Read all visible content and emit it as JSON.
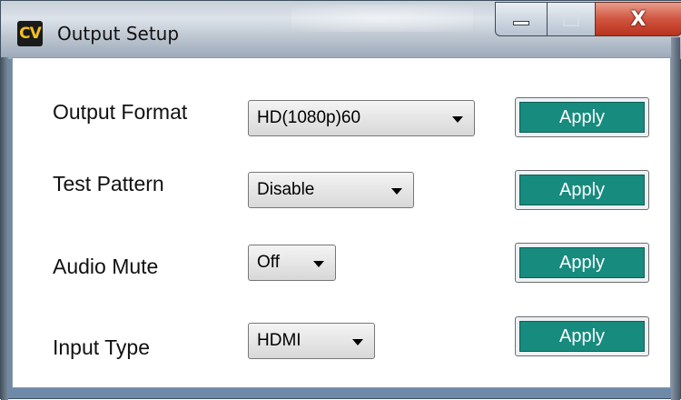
{
  "window": {
    "title": "Output Setup",
    "icon_text": "CV",
    "icon_name": "cv-app-icon",
    "close_glyph": "X"
  },
  "rows": [
    {
      "label": "Output Format",
      "value": "HD(1080p)60",
      "button": "Apply"
    },
    {
      "label": "Test Pattern",
      "value": "Disable",
      "button": "Apply"
    },
    {
      "label": "Audio Mute",
      "value": "Off",
      "button": "Apply"
    },
    {
      "label": "Input Type",
      "value": "HDMI",
      "button": "Apply"
    }
  ],
  "colors": {
    "apply_button": "#178b7e",
    "close_button": "#c9432d",
    "app_icon_text": "#f3c020"
  }
}
